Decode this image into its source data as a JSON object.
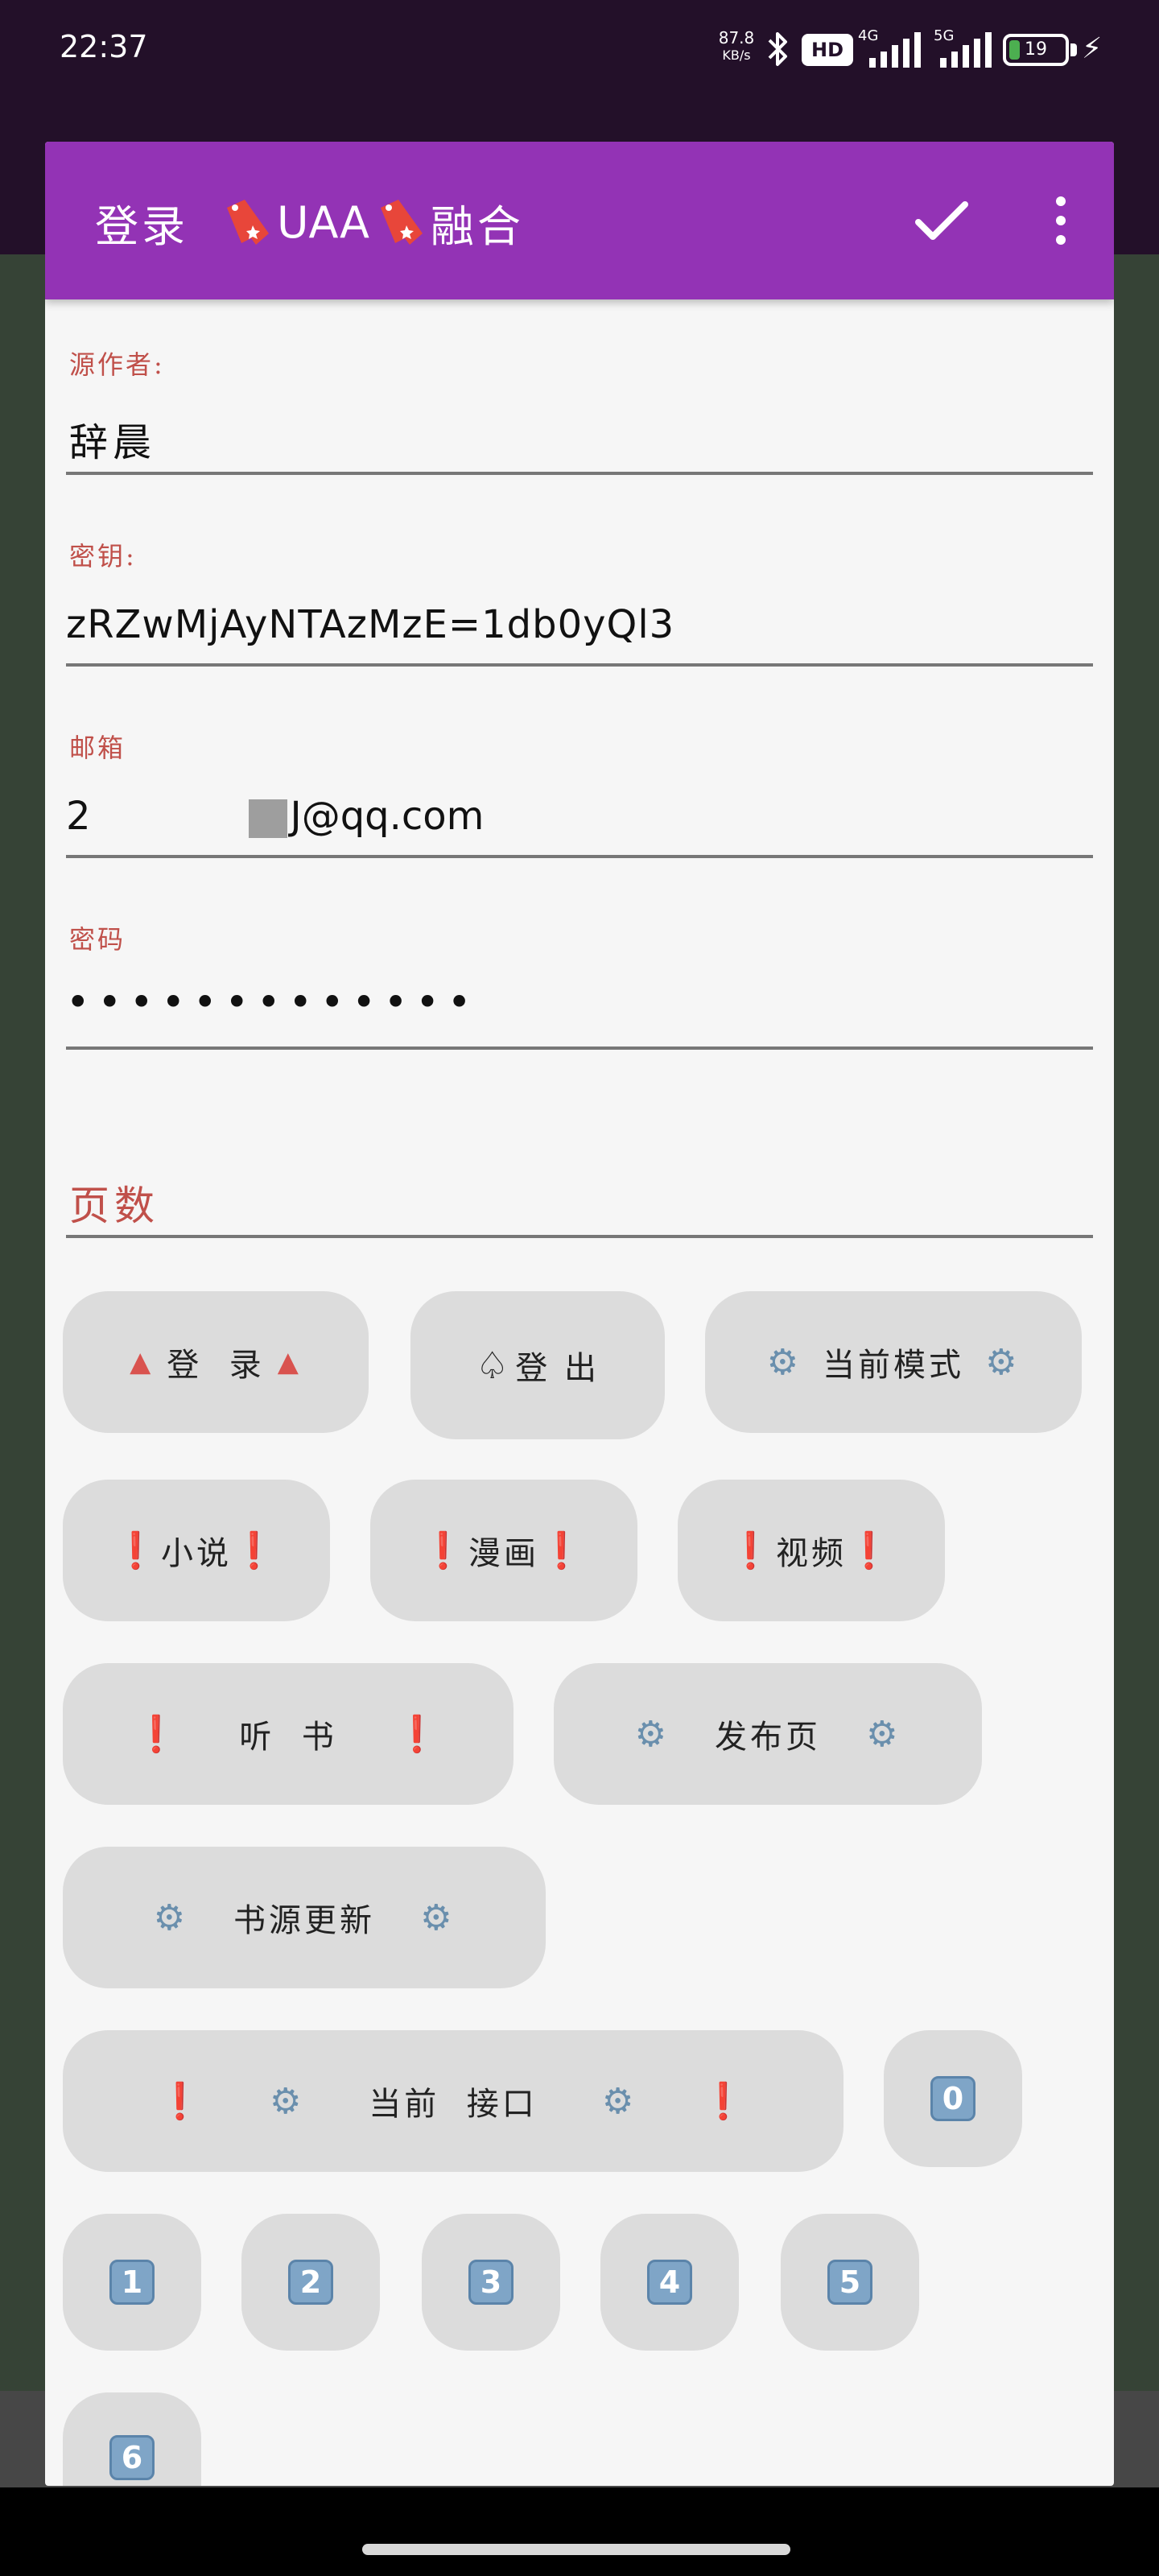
{
  "status_bar": {
    "time": "22:37",
    "net_speed_value": "87.8",
    "net_speed_unit": "KB/s",
    "hd_label": "HD",
    "signal1_label": "4G",
    "signal2_label": "5G",
    "battery_level": "19"
  },
  "app_bar": {
    "title_part1": "登录",
    "title_part2": "UAA",
    "title_part3": "融合"
  },
  "fields": {
    "author_label": "源作者:",
    "author_value": "辞晨",
    "key_label": "密钥:",
    "key_value": "zRZwMjAyNTAzMzE=1db0yQl3",
    "email_label": "邮箱",
    "email_prefix": "2",
    "email_suffix": "J@qq.com",
    "password_label": "密码",
    "password_value": "•••••••••••••",
    "pages_label": "页数"
  },
  "buttons": {
    "login": "登  录",
    "logout": "登 出",
    "current_mode": "当前模式",
    "novel": "小说",
    "comic": "漫画",
    "video": "视频",
    "audiobook": "听  书",
    "publish_page": "发布页",
    "source_update": "书源更新",
    "current_api": "当前  接口",
    "num_0": "0",
    "num_1": "1",
    "num_2": "2",
    "num_3": "3",
    "num_4": "4",
    "num_5": "5",
    "num_6": "6"
  },
  "colors": {
    "app_bar": "#9333b5",
    "label": "#c0504a",
    "button_bg": "#dcdcdc",
    "keycap": "#7fa5c7"
  }
}
